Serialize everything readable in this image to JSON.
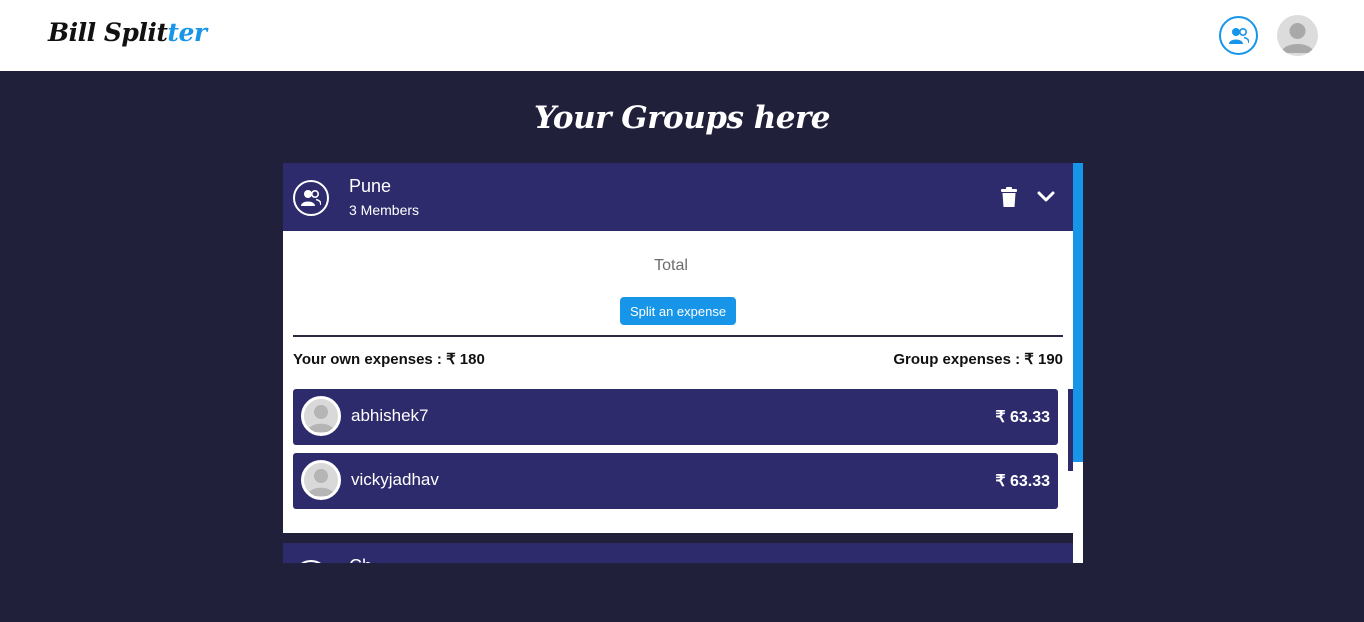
{
  "navbar": {
    "brand_part1": "Bill Split",
    "brand_part2": "ter",
    "groups_icon": "user-group-icon",
    "avatar_icon": "profile-avatar-icon"
  },
  "page": {
    "title": "Your Groups here"
  },
  "groups": [
    {
      "name": "Pune",
      "members_label": "3 Members",
      "icon": "user-group-icon",
      "delete_icon": "trash-icon",
      "expand_icon": "chevron-down-icon",
      "total_label": "Total",
      "split_button_label": "Split an expense",
      "own_expenses": "Your own expenses : ₹ 180",
      "group_expenses": "Group expenses : ₹ 190",
      "members": [
        {
          "name": "abhishek7",
          "amount": "₹ 63.33"
        },
        {
          "name": "vickyjadhav",
          "amount": "₹ 63.33"
        }
      ]
    },
    {
      "name": "Ch",
      "members_label": "",
      "icon": "user-group-icon"
    }
  ],
  "colors": {
    "accent": "#1795e8",
    "background": "#20203a",
    "card_header": "#2d2b6c",
    "white": "#ffffff"
  }
}
